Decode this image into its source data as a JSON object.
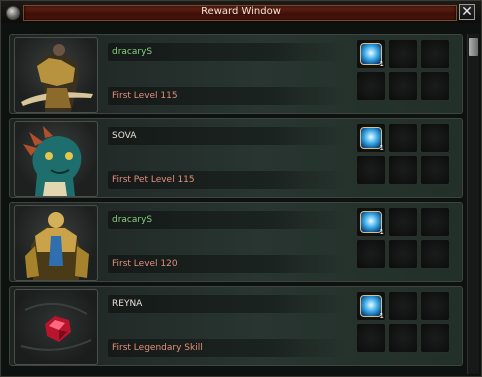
{
  "window": {
    "title": "Reward Window",
    "close_symbol": "✕"
  },
  "entries": [
    {
      "name": "dracaryS",
      "name_color": "#86d07c",
      "description": "First Level 115",
      "reward_count": "1"
    },
    {
      "name": "SOVA",
      "name_color": "#e6e2d6",
      "description": "First Pet Level 115",
      "reward_count": "1"
    },
    {
      "name": "dracaryS",
      "name_color": "#86d07c",
      "description": "First Level 120",
      "reward_count": "1"
    },
    {
      "name": "REYNA",
      "name_color": "#e6e2d6",
      "description": "First Legendary Skill",
      "reward_count": "1"
    }
  ]
}
